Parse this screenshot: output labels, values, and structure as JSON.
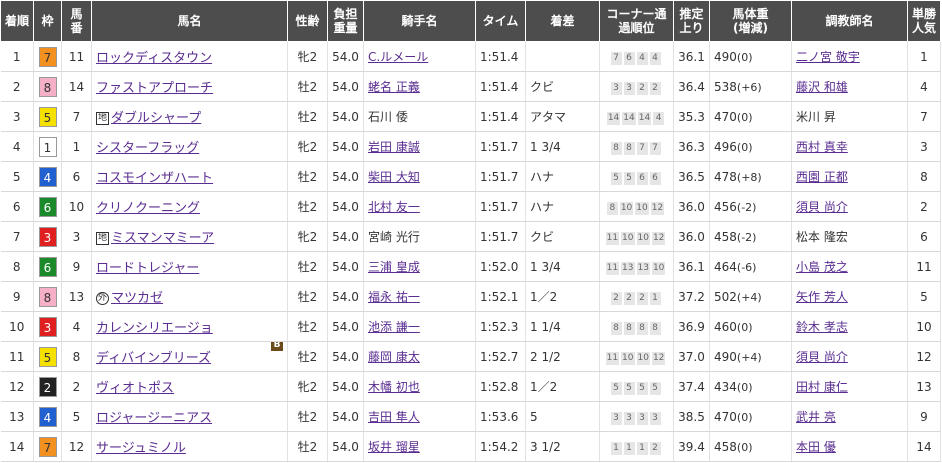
{
  "headers": {
    "rank": "着順",
    "waku": "枠",
    "num": "馬番",
    "horse": "馬名",
    "sexage": "性齢",
    "weight": "負担重量",
    "jockey": "騎手名",
    "time": "タイム",
    "margin": "着差",
    "corner": "コーナー通過順位",
    "last": "推定上り",
    "bw": "馬体重(増減)",
    "trainer": "調教師名",
    "pop": "単勝人気"
  },
  "waku_colors": {
    "1": "#ffffff",
    "2": "#222222",
    "3": "#e02020",
    "4": "#2060d0",
    "5": "#f5e000",
    "6": "#1a8a2a",
    "7": "#f29020",
    "8": "#f5b0c8"
  },
  "rows": [
    {
      "rank": "1",
      "waku": "7",
      "num": "11",
      "tag": "",
      "horse": "ロックディスタウン",
      "blinker": "",
      "sex": "牝2",
      "weight": "54.0",
      "jockey": "C.ルメール",
      "jlink": true,
      "time": "1:51.4",
      "margin": "",
      "corner": [
        "7",
        "6",
        "4",
        "4"
      ],
      "last": "36.1",
      "bw": "490",
      "bwd": "(0)",
      "trainer": "二ノ宮 敬宇",
      "tlink": true,
      "pop": "1"
    },
    {
      "rank": "2",
      "waku": "8",
      "num": "14",
      "tag": "",
      "horse": "ファストアプローチ",
      "blinker": "",
      "sex": "牡2",
      "weight": "54.0",
      "jockey": "蛯名 正義",
      "jlink": true,
      "time": "1:51.4",
      "margin": "クビ",
      "corner": [
        "3",
        "3",
        "2",
        "2"
      ],
      "last": "36.4",
      "bw": "538",
      "bwd": "(+6)",
      "trainer": "藤沢 和雄",
      "tlink": true,
      "pop": "4"
    },
    {
      "rank": "3",
      "waku": "5",
      "num": "7",
      "tag": "地",
      "horse": "ダブルシャープ",
      "blinker": "",
      "sex": "牡2",
      "weight": "54.0",
      "jockey": "石川 倭",
      "jlink": false,
      "time": "1:51.4",
      "margin": "アタマ",
      "corner": [
        "14",
        "14",
        "14",
        "4"
      ],
      "last": "35.3",
      "bw": "470",
      "bwd": "(0)",
      "trainer": "米川 昇",
      "tlink": false,
      "pop": "7"
    },
    {
      "rank": "4",
      "waku": "1",
      "num": "1",
      "tag": "",
      "horse": "シスターフラッグ",
      "blinker": "",
      "sex": "牝2",
      "weight": "54.0",
      "jockey": "岩田 康誠",
      "jlink": true,
      "time": "1:51.7",
      "margin": "1 3/4",
      "corner": [
        "8",
        "8",
        "7",
        "7"
      ],
      "last": "36.3",
      "bw": "496",
      "bwd": "(0)",
      "trainer": "西村 真幸",
      "tlink": true,
      "pop": "3"
    },
    {
      "rank": "5",
      "waku": "4",
      "num": "6",
      "tag": "",
      "horse": "コスモインザハート",
      "blinker": "",
      "sex": "牡2",
      "weight": "54.0",
      "jockey": "柴田 大知",
      "jlink": true,
      "time": "1:51.7",
      "margin": "ハナ",
      "corner": [
        "5",
        "5",
        "6",
        "6"
      ],
      "last": "36.5",
      "bw": "478",
      "bwd": "(+8)",
      "trainer": "西園 正都",
      "tlink": true,
      "pop": "8"
    },
    {
      "rank": "6",
      "waku": "6",
      "num": "10",
      "tag": "",
      "horse": "クリノクーニング",
      "blinker": "",
      "sex": "牡2",
      "weight": "54.0",
      "jockey": "北村 友一",
      "jlink": true,
      "time": "1:51.7",
      "margin": "ハナ",
      "corner": [
        "8",
        "10",
        "10",
        "12"
      ],
      "last": "36.0",
      "bw": "456",
      "bwd": "(-2)",
      "trainer": "須貝 尚介",
      "tlink": true,
      "pop": "2"
    },
    {
      "rank": "7",
      "waku": "3",
      "num": "3",
      "tag": "地",
      "horse": "ミスマンマミーア",
      "blinker": "",
      "sex": "牝2",
      "weight": "54.0",
      "jockey": "宮崎 光行",
      "jlink": false,
      "time": "1:51.7",
      "margin": "クビ",
      "corner": [
        "11",
        "10",
        "10",
        "12"
      ],
      "last": "36.0",
      "bw": "458",
      "bwd": "(-2)",
      "trainer": "松本 隆宏",
      "tlink": false,
      "pop": "6"
    },
    {
      "rank": "8",
      "waku": "6",
      "num": "9",
      "tag": "",
      "horse": "ロードトレジャー",
      "blinker": "",
      "sex": "牡2",
      "weight": "54.0",
      "jockey": "三浦 皇成",
      "jlink": true,
      "time": "1:52.0",
      "margin": "1 3/4",
      "corner": [
        "11",
        "13",
        "13",
        "10"
      ],
      "last": "36.1",
      "bw": "464",
      "bwd": "(-6)",
      "trainer": "小島 茂之",
      "tlink": true,
      "pop": "11"
    },
    {
      "rank": "9",
      "waku": "8",
      "num": "13",
      "tag": "外",
      "horse": "マツカゼ",
      "blinker": "",
      "sex": "牡2",
      "weight": "54.0",
      "jockey": "福永 祐一",
      "jlink": true,
      "time": "1:52.1",
      "margin": "1／2",
      "corner": [
        "2",
        "2",
        "2",
        "1"
      ],
      "last": "37.2",
      "bw": "502",
      "bwd": "(+4)",
      "trainer": "矢作 芳人",
      "tlink": true,
      "pop": "5"
    },
    {
      "rank": "10",
      "waku": "3",
      "num": "4",
      "tag": "",
      "horse": "カレンシリエージョ",
      "blinker": "",
      "sex": "牡2",
      "weight": "54.0",
      "jockey": "池添 謙一",
      "jlink": true,
      "time": "1:52.3",
      "margin": "1 1/4",
      "corner": [
        "8",
        "8",
        "8",
        "8"
      ],
      "last": "36.9",
      "bw": "460",
      "bwd": "(0)",
      "trainer": "鈴木 孝志",
      "tlink": true,
      "pop": "10"
    },
    {
      "rank": "11",
      "waku": "5",
      "num": "8",
      "tag": "",
      "horse": "ディバインブリーズ",
      "blinker": "B",
      "sex": "牡2",
      "weight": "54.0",
      "jockey": "藤岡 康太",
      "jlink": true,
      "time": "1:52.7",
      "margin": "2 1/2",
      "corner": [
        "11",
        "10",
        "10",
        "12"
      ],
      "last": "37.0",
      "bw": "490",
      "bwd": "(+4)",
      "trainer": "須貝 尚介",
      "tlink": true,
      "pop": "12"
    },
    {
      "rank": "12",
      "waku": "2",
      "num": "2",
      "tag": "",
      "horse": "ヴィオトポス",
      "blinker": "",
      "sex": "牝2",
      "weight": "54.0",
      "jockey": "木幡 初也",
      "jlink": true,
      "time": "1:52.8",
      "margin": "1／2",
      "corner": [
        "5",
        "5",
        "5",
        "5"
      ],
      "last": "37.4",
      "bw": "434",
      "bwd": "(0)",
      "trainer": "田村 康仁",
      "tlink": true,
      "pop": "13"
    },
    {
      "rank": "13",
      "waku": "4",
      "num": "5",
      "tag": "",
      "horse": "ロジャージーニアス",
      "blinker": "",
      "sex": "牡2",
      "weight": "54.0",
      "jockey": "吉田 隼人",
      "jlink": true,
      "time": "1:53.6",
      "margin": "5",
      "corner": [
        "3",
        "3",
        "3",
        "3"
      ],
      "last": "38.5",
      "bw": "470",
      "bwd": "(0)",
      "trainer": "武井 亮",
      "tlink": true,
      "pop": "9"
    },
    {
      "rank": "14",
      "waku": "7",
      "num": "12",
      "tag": "",
      "horse": "サージュミノル",
      "blinker": "",
      "sex": "牡2",
      "weight": "54.0",
      "jockey": "坂井 瑠星",
      "jlink": true,
      "time": "1:54.2",
      "margin": "3 1/2",
      "corner": [
        "1",
        "1",
        "1",
        "2"
      ],
      "last": "39.4",
      "bw": "458",
      "bwd": "(0)",
      "trainer": "本田 優",
      "tlink": true,
      "pop": "14"
    }
  ]
}
